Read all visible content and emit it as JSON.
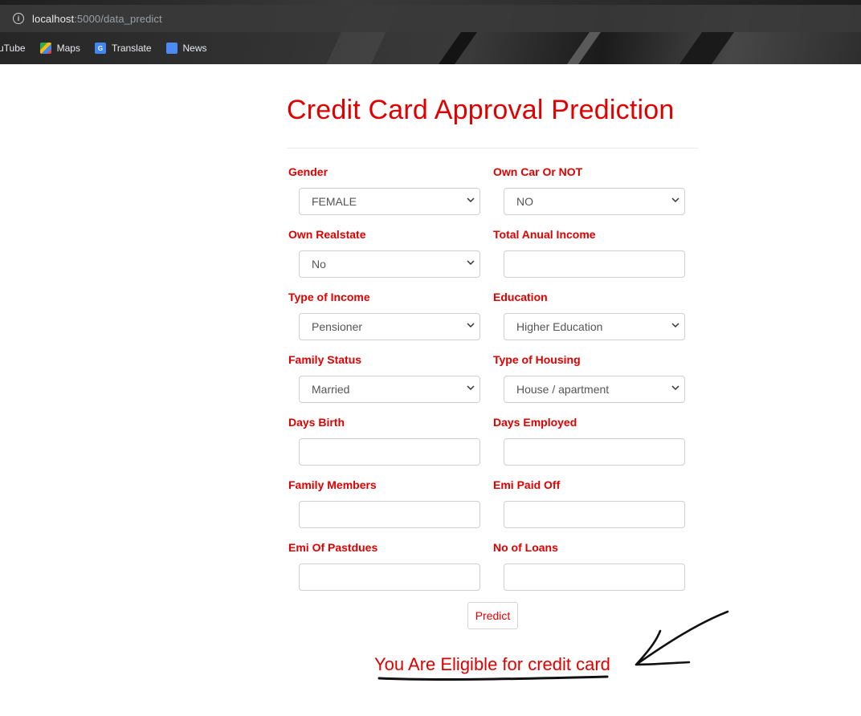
{
  "browser": {
    "url_host": "localhost",
    "url_rest": ":5000/data_predict",
    "bookmarks": [
      {
        "label": "uTube",
        "icon": "youtube-icon"
      },
      {
        "label": "Maps",
        "icon": "maps-icon"
      },
      {
        "label": "Translate",
        "icon": "translate-icon"
      },
      {
        "label": "News",
        "icon": "news-icon"
      }
    ]
  },
  "page": {
    "title": "Credit Card Approval Prediction",
    "predict_label": "Predict",
    "result": "You Are Eligible for credit card"
  },
  "form": {
    "gender": {
      "label": "Gender",
      "value": "FEMALE"
    },
    "own_car": {
      "label": "Own Car Or NOT",
      "value": "NO"
    },
    "own_realstate": {
      "label": "Own Realstate",
      "value": "No"
    },
    "total_income": {
      "label": "Total Anual Income",
      "value": ""
    },
    "type_income": {
      "label": "Type of Income",
      "value": "Pensioner"
    },
    "education": {
      "label": "Education",
      "value": "Higher Education"
    },
    "family_status": {
      "label": "Family Status",
      "value": "Married"
    },
    "housing": {
      "label": "Type of Housing",
      "value": "House / apartment"
    },
    "days_birth": {
      "label": "Days Birth",
      "value": ""
    },
    "days_employed": {
      "label": "Days Employed",
      "value": ""
    },
    "family_members": {
      "label": "Family Members",
      "value": ""
    },
    "emi_paid_off": {
      "label": "Emi Paid Off",
      "value": ""
    },
    "emi_pastdues": {
      "label": "Emi Of Pastdues",
      "value": ""
    },
    "no_of_loans": {
      "label": "No of Loans",
      "value": ""
    }
  },
  "colors": {
    "accent": "#e00000",
    "annotation_ink": "#111111"
  }
}
